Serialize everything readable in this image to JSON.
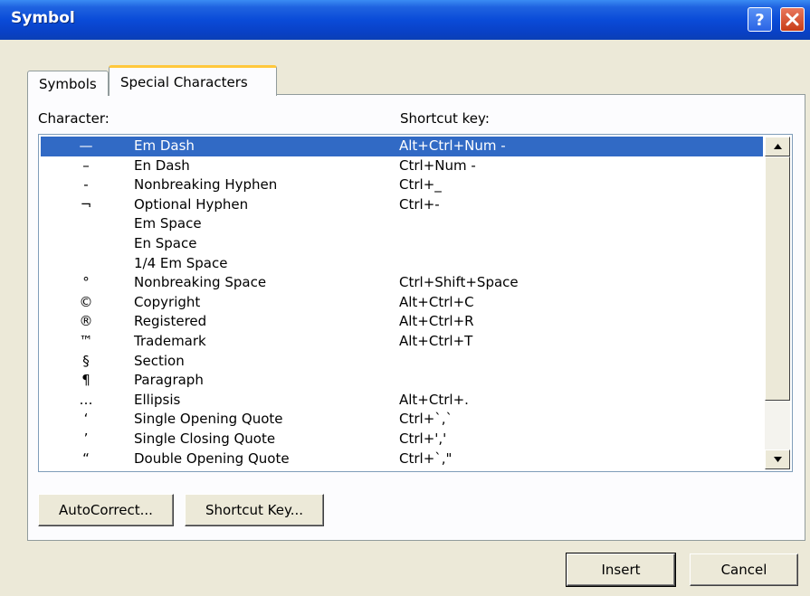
{
  "window": {
    "title": "Symbol",
    "help_glyph": "?"
  },
  "tabs": [
    {
      "label": "Symbols",
      "active": false
    },
    {
      "label": "Special Characters",
      "active": true
    }
  ],
  "columns": {
    "character": "Character:",
    "shortcut": "Shortcut key:"
  },
  "rows": [
    {
      "symbol": "—",
      "name": "Em Dash",
      "shortcut": "Alt+Ctrl+Num -",
      "selected": true
    },
    {
      "symbol": "–",
      "name": "En Dash",
      "shortcut": "Ctrl+Num -"
    },
    {
      "symbol": "-",
      "name": "Nonbreaking Hyphen",
      "shortcut": "Ctrl+_"
    },
    {
      "symbol": "¬",
      "name": "Optional Hyphen",
      "shortcut": "Ctrl+-"
    },
    {
      "symbol": "",
      "name": "Em Space",
      "shortcut": ""
    },
    {
      "symbol": "",
      "name": "En Space",
      "shortcut": ""
    },
    {
      "symbol": "",
      "name": "1/4 Em Space",
      "shortcut": ""
    },
    {
      "symbol": "°",
      "name": "Nonbreaking Space",
      "shortcut": "Ctrl+Shift+Space"
    },
    {
      "symbol": "©",
      "name": "Copyright",
      "shortcut": "Alt+Ctrl+C"
    },
    {
      "symbol": "®",
      "name": "Registered",
      "shortcut": "Alt+Ctrl+R"
    },
    {
      "symbol": "™",
      "name": "Trademark",
      "shortcut": "Alt+Ctrl+T"
    },
    {
      "symbol": "§",
      "name": "Section",
      "shortcut": ""
    },
    {
      "symbol": "¶",
      "name": "Paragraph",
      "shortcut": ""
    },
    {
      "symbol": "…",
      "name": "Ellipsis",
      "shortcut": "Alt+Ctrl+."
    },
    {
      "symbol": "‘",
      "name": "Single Opening Quote",
      "shortcut": "Ctrl+`,`"
    },
    {
      "symbol": "’",
      "name": "Single Closing Quote",
      "shortcut": "Ctrl+','"
    },
    {
      "symbol": "“",
      "name": "Double Opening Quote",
      "shortcut": "Ctrl+`,\""
    }
  ],
  "buttons": {
    "autocorrect": "AutoCorrect...",
    "shortcut_key": "Shortcut Key...",
    "insert": "Insert",
    "cancel": "Cancel"
  },
  "colors": {
    "selection": "#316ac5",
    "titlebar": "#0a4bd8",
    "dialog_bg": "#ece9d8"
  }
}
